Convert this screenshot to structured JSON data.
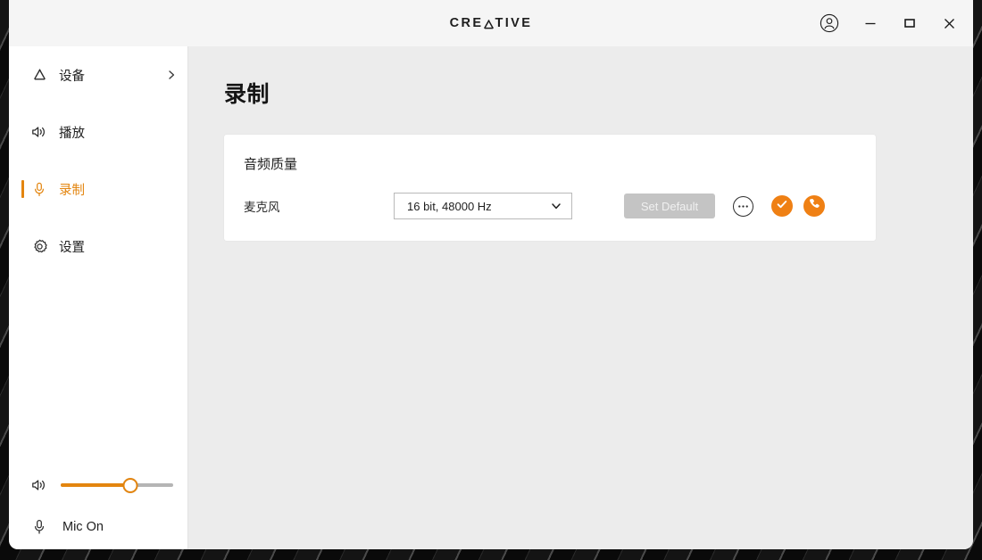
{
  "window": {
    "brand": {
      "prefix": "CRE",
      "a_letter": "A",
      "suffix": "TIVE"
    },
    "controls": {
      "account": "account-icon",
      "minimize": "minimize-icon",
      "maximize": "maximize-icon",
      "close": "close-icon"
    }
  },
  "sidebar": {
    "items": [
      {
        "label": "设备",
        "icon": "device-icon",
        "active": false,
        "chevron": "chevron-right-icon"
      },
      {
        "label": "播放",
        "icon": "speaker-icon",
        "active": false
      },
      {
        "label": "录制",
        "icon": "microphone-icon",
        "active": true
      },
      {
        "label": "设置",
        "icon": "gear-icon",
        "active": false
      }
    ],
    "volume": {
      "icon": "speaker-icon",
      "value": 62,
      "min": 0,
      "max": 100
    },
    "mic_status": {
      "icon": "microphone-icon",
      "label": "Mic On"
    }
  },
  "main": {
    "title": "录制",
    "card": {
      "heading": "音频质量",
      "row": {
        "label": "麦克风",
        "select": {
          "value": "16 bit, 48000 Hz",
          "arrow": "chevron-down-icon"
        },
        "set_default_label": "Set Default",
        "more_icon": "ellipsis-icon",
        "default_device_badge": "check-icon",
        "default_comm_badge": "phone-icon"
      }
    }
  },
  "colors": {
    "accent": "#e3850f",
    "badge": "#ef8014",
    "sidebar_bg": "#ffffff",
    "content_bg": "#ececec",
    "titlebar_bg": "#f5f5f5"
  }
}
